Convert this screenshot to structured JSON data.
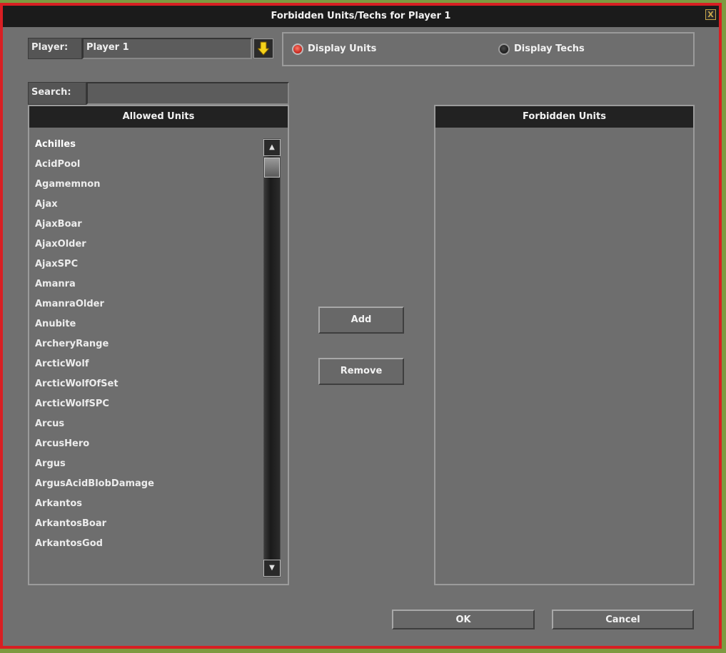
{
  "window": {
    "title": "Forbidden Units/Techs for Player 1",
    "close_label": "X"
  },
  "player": {
    "label": "Player:",
    "value": "Player 1"
  },
  "display_mode": {
    "units_label": "Display Units",
    "techs_label": "Display Techs",
    "selected": "units"
  },
  "search": {
    "label": "Search:",
    "value": ""
  },
  "allowed": {
    "header": "Allowed Units",
    "items": [
      "Achilles",
      "AcidPool",
      "Agamemnon",
      "Ajax",
      "AjaxBoar",
      "AjaxOlder",
      "AjaxSPC",
      "Amanra",
      "AmanraOlder",
      "Anubite",
      "ArcheryRange",
      "ArcticWolf",
      "ArcticWolfOfSet",
      "ArcticWolfSPC",
      "Arcus",
      "ArcusHero",
      "Argus",
      "ArgusAcidBlobDamage",
      "Arkantos",
      "ArkantosBoar",
      "ArkantosGod"
    ]
  },
  "forbidden": {
    "header": "Forbidden Units",
    "items": []
  },
  "buttons": {
    "add": "Add",
    "remove": "Remove",
    "ok": "OK",
    "cancel": "Cancel"
  },
  "colors": {
    "accent_border": "#d81f23",
    "dialog_bg": "#707070",
    "header_bg": "#222222"
  }
}
